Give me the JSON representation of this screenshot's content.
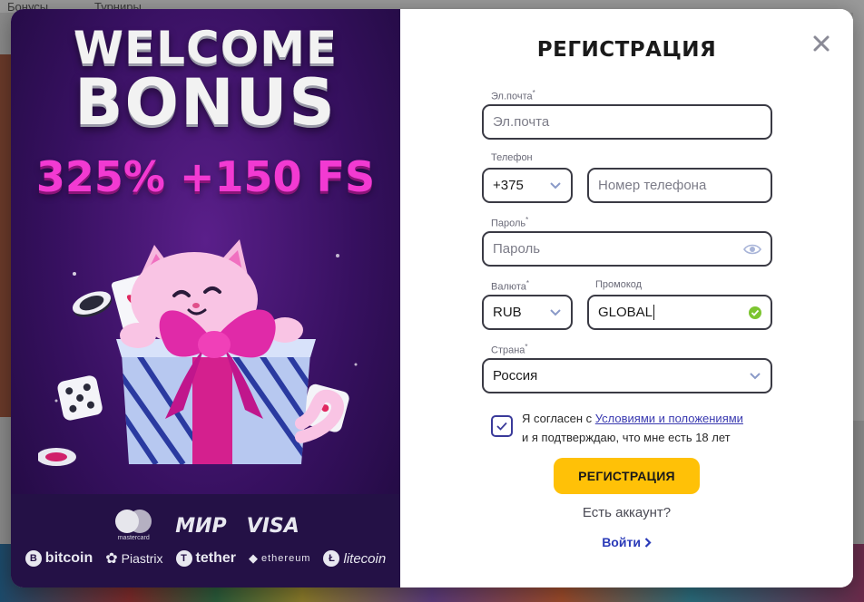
{
  "background": {
    "nav_items": [
      "Бонусы",
      "Турниры"
    ]
  },
  "promo": {
    "headline_line1": "WELCOME",
    "headline_line2": "BONUS",
    "offer": "325% +150 FS",
    "payments_row1": {
      "mastercard_caption": "mastercard",
      "mir": "МИР",
      "visa": "VISA"
    },
    "payments_row2": {
      "bitcoin": "bitcoin",
      "piastrix": "Piastrix",
      "tether": "tether",
      "ethereum": "ethereum",
      "litecoin": "litecoin"
    }
  },
  "form": {
    "title": "РЕГИСТРАЦИЯ",
    "email": {
      "label": "Эл.почта",
      "required_mark": "*",
      "placeholder": "Эл.почта"
    },
    "phone": {
      "label": "Телефон",
      "code": "+375",
      "placeholder": "Номер телефона"
    },
    "password": {
      "label": "Пароль",
      "required_mark": "*",
      "placeholder": "Пароль"
    },
    "currency": {
      "label": "Валюта",
      "required_mark": "*",
      "value": "RUB"
    },
    "promo_code": {
      "label": "Промокод",
      "value": "GLOBAL"
    },
    "country": {
      "label": "Страна",
      "required_mark": "*",
      "value": "Россия"
    },
    "terms": {
      "prefix": "Я согласен с ",
      "link": "Условиями и положениями",
      "suffix": "и я подтверждаю, что мне есть 18 лет",
      "checked": true
    },
    "submit_label": "РЕГИСТРАЦИЯ",
    "has_account": "Есть аккаунт?",
    "login_label": "Войти",
    "colors": {
      "accent": "#ffc107",
      "link": "#2a3ab8",
      "valid": "#7cc530"
    }
  }
}
